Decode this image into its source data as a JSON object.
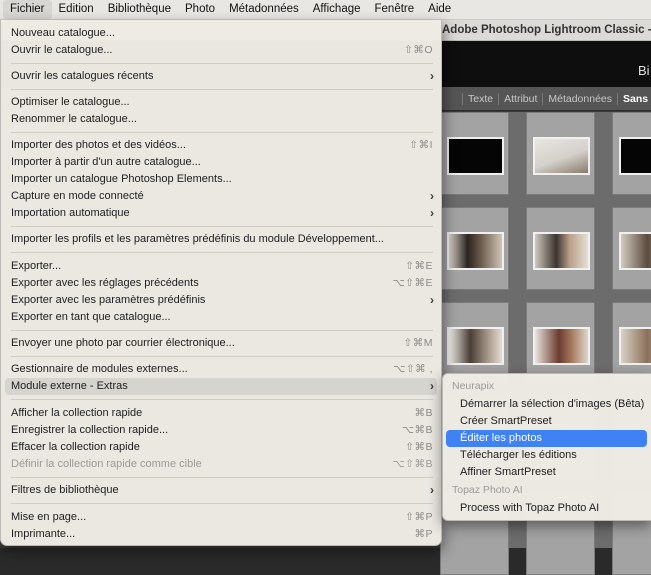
{
  "menubar": {
    "items": [
      "Fichier",
      "Edition",
      "Bibliothèque",
      "Photo",
      "Métadonnées",
      "Affichage",
      "Fenêtre",
      "Aide"
    ]
  },
  "app": {
    "title": "Adobe Photoshop Lightroom Classic - Bibliothèque",
    "module": "Bi",
    "filters": [
      "Texte",
      "Attribut",
      "Métadonnées",
      "Sans"
    ]
  },
  "file_menu": {
    "items": [
      {
        "label": "Nouveau catalogue...",
        "shortcut": ""
      },
      {
        "label": "Ouvrir le catalogue...",
        "shortcut": "⇧⌘O"
      },
      {
        "label": "Ouvrir les catalogues récents",
        "submenu": true
      },
      {
        "label": "Optimiser le catalogue...",
        "shortcut": ""
      },
      {
        "label": "Renommer le catalogue...",
        "shortcut": ""
      },
      {
        "label": "Importer des photos et des vidéos...",
        "shortcut": "⇧⌘I"
      },
      {
        "label": "Importer à partir d'un autre catalogue...",
        "shortcut": ""
      },
      {
        "label": "Importer un catalogue Photoshop Elements...",
        "shortcut": ""
      },
      {
        "label": "Capture en mode connecté",
        "submenu": true
      },
      {
        "label": "Importation automatique",
        "submenu": true
      },
      {
        "label": "Importer les profils et les paramètres prédéfinis du module Développement...",
        "shortcut": ""
      },
      {
        "label": "Exporter...",
        "shortcut": "⇧⌘E"
      },
      {
        "label": "Exporter avec les réglages précédents",
        "shortcut": "⌥⇧⌘E"
      },
      {
        "label": "Exporter avec les paramètres prédéfinis",
        "submenu": true
      },
      {
        "label": "Exporter en tant que catalogue...",
        "shortcut": ""
      },
      {
        "label": "Envoyer une photo par courrier électronique...",
        "shortcut": "⇧⌘M"
      },
      {
        "label": "Gestionnaire de modules externes...",
        "shortcut": "⌥⇧⌘ ,"
      },
      {
        "label": "Module externe - Extras",
        "submenu": true
      },
      {
        "label": "Afficher la collection rapide",
        "shortcut": "⌘B"
      },
      {
        "label": "Enregistrer la collection rapide...",
        "shortcut": "⌥⌘B"
      },
      {
        "label": "Effacer la collection rapide",
        "shortcut": "⇧⌘B"
      },
      {
        "label": "Définir la collection rapide comme cible",
        "shortcut": "⌥⇧⌘B"
      },
      {
        "label": "Filtres de bibliothèque",
        "submenu": true
      },
      {
        "label": "Mise en page...",
        "shortcut": "⇧⌘P"
      },
      {
        "label": "Imprimante...",
        "shortcut": "⌘P"
      }
    ]
  },
  "submenu": {
    "group1_header": "Neurapix",
    "group1_items": [
      "Démarrer la sélection d'images (Bêta)",
      "Créer SmartPreset",
      "Éditer les photos",
      "Télécharger les éditions",
      "Affiner SmartPreset"
    ],
    "group2_header": "Topaz Photo AI",
    "group2_items": [
      "Process with Topaz Photo AI"
    ]
  }
}
